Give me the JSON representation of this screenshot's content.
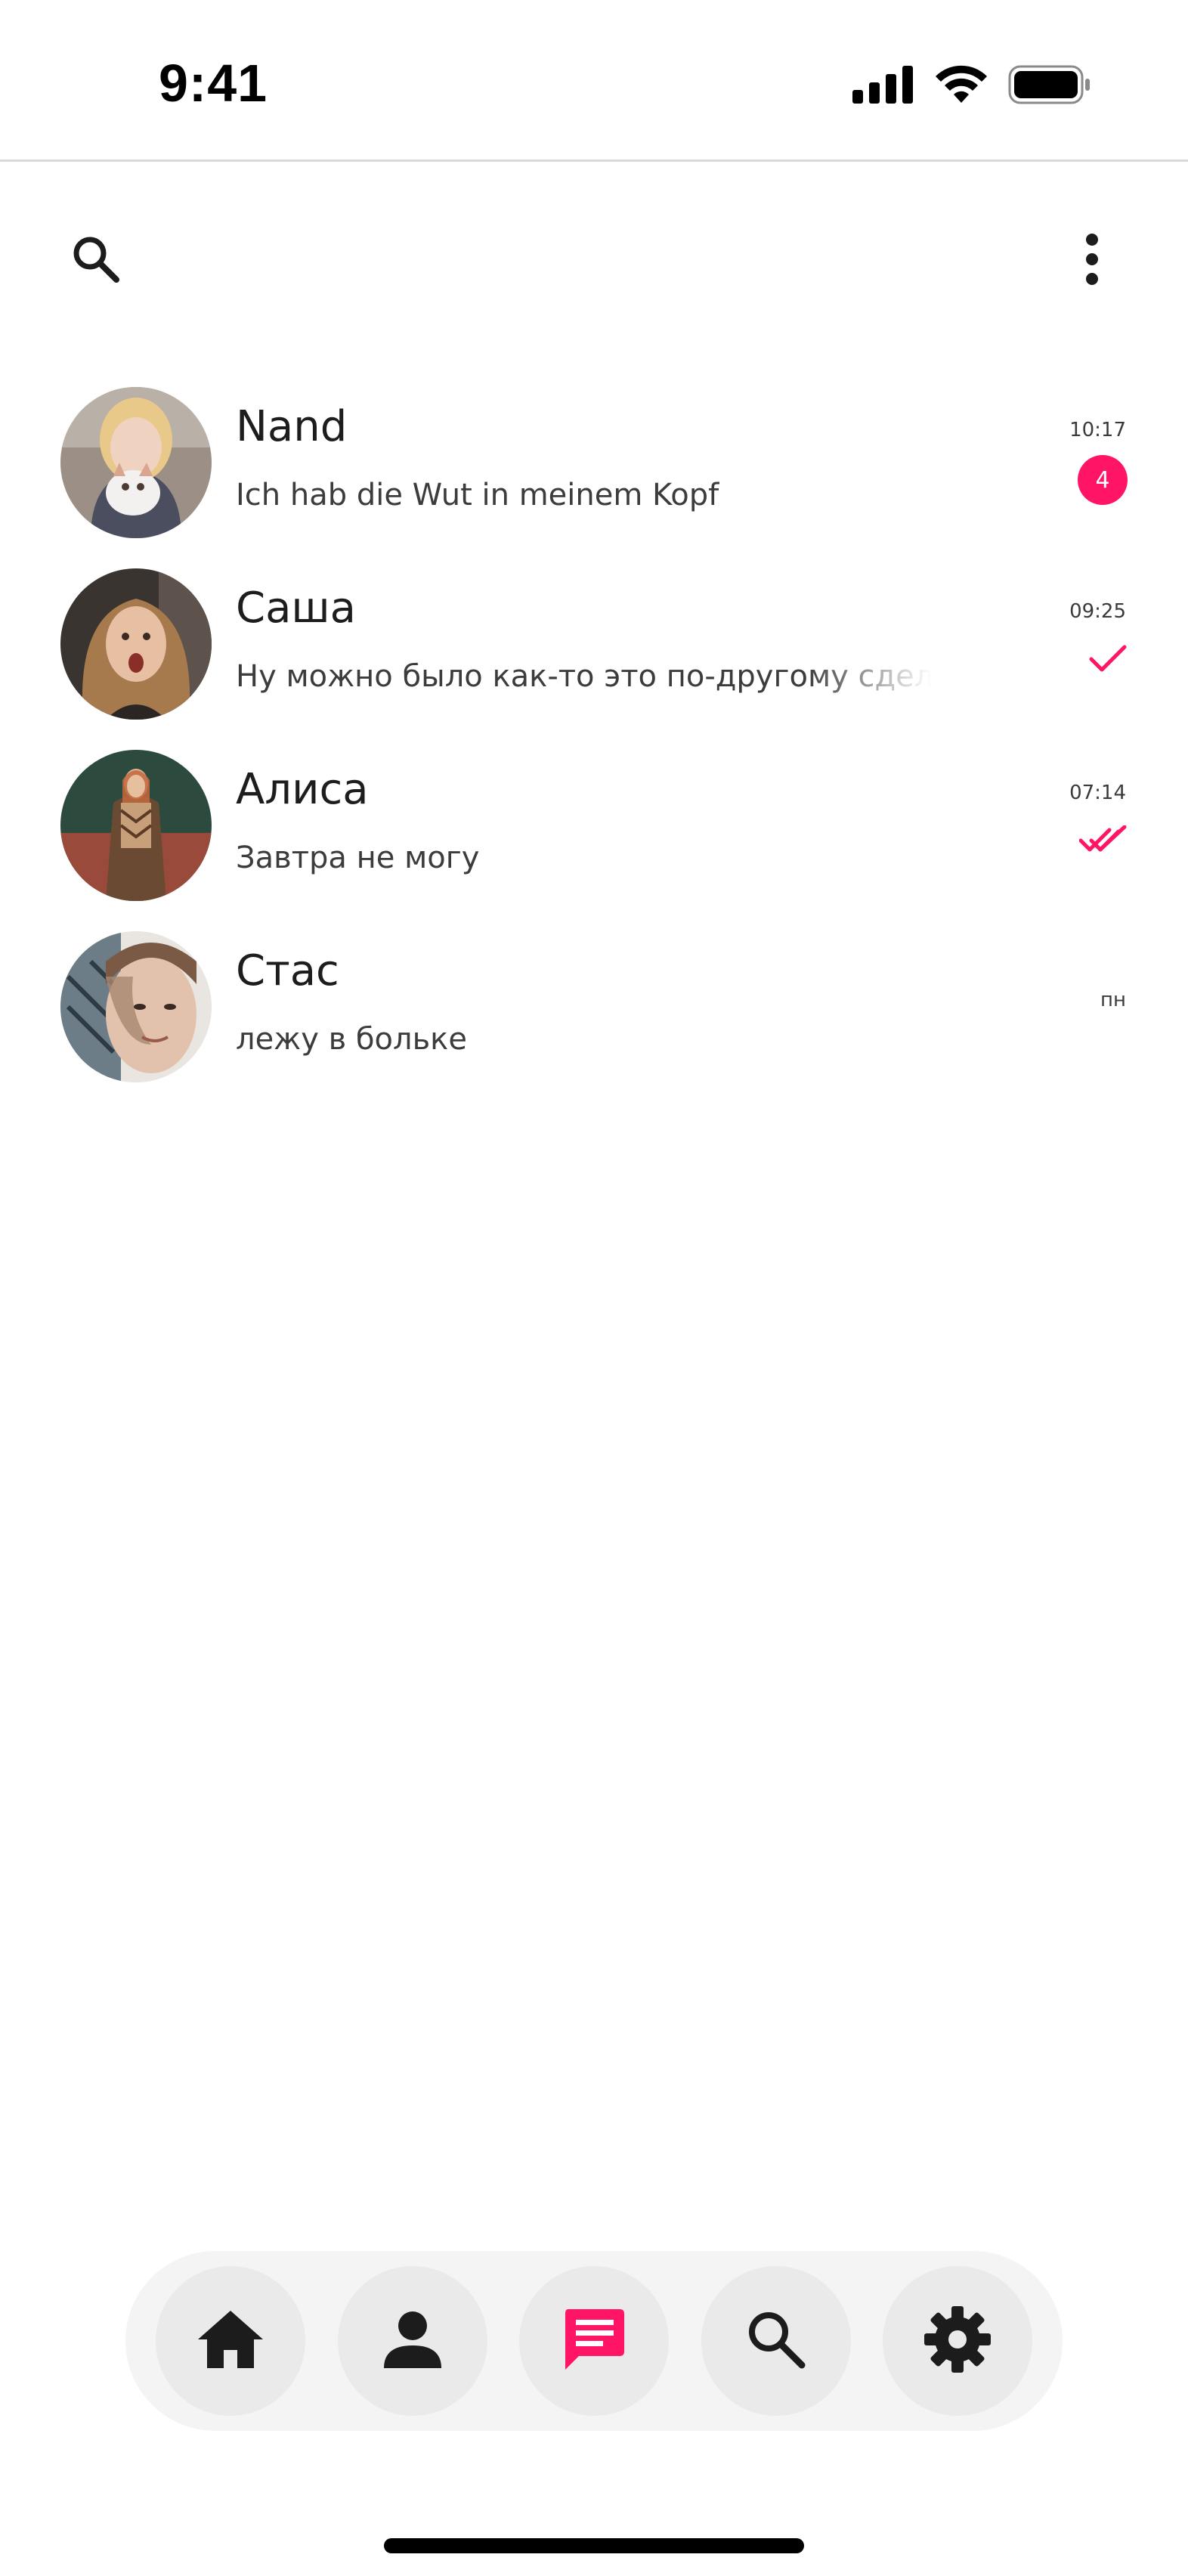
{
  "status_bar": {
    "time": "9:41",
    "signal_icon": "cellular-signal-icon",
    "wifi_icon": "wifi-icon",
    "battery_icon": "battery-icon"
  },
  "header": {
    "search_icon": "search-icon",
    "menu_icon": "more-vertical-icon"
  },
  "colors": {
    "accent": "#ff1466",
    "text": "#1c1c1c",
    "nav_background": "#f4f4f4",
    "nav_button": "#eaeaea"
  },
  "chats": [
    {
      "name": "Nand",
      "preview": "Ich hab die Wut in meinem Kopf",
      "time": "10:17",
      "unread": "4",
      "status": "unread"
    },
    {
      "name": "Саша",
      "preview": "Ну можно было как-то это по-другому сделать",
      "time": "09:25",
      "status": "sent-check-icon"
    },
    {
      "name": "Алиса",
      "preview": "Завтра не могу",
      "time": "07:14",
      "status": "read-double-check-icon"
    },
    {
      "name": "Стас",
      "preview": "лежу в больке",
      "time": "пн",
      "status": "none"
    }
  ],
  "bottom_nav": {
    "items": [
      {
        "icon": "home-icon",
        "active": false
      },
      {
        "icon": "profile-icon",
        "active": false
      },
      {
        "icon": "chat-icon",
        "active": true
      },
      {
        "icon": "search-icon",
        "active": false
      },
      {
        "icon": "settings-gear-icon",
        "active": false
      }
    ]
  }
}
